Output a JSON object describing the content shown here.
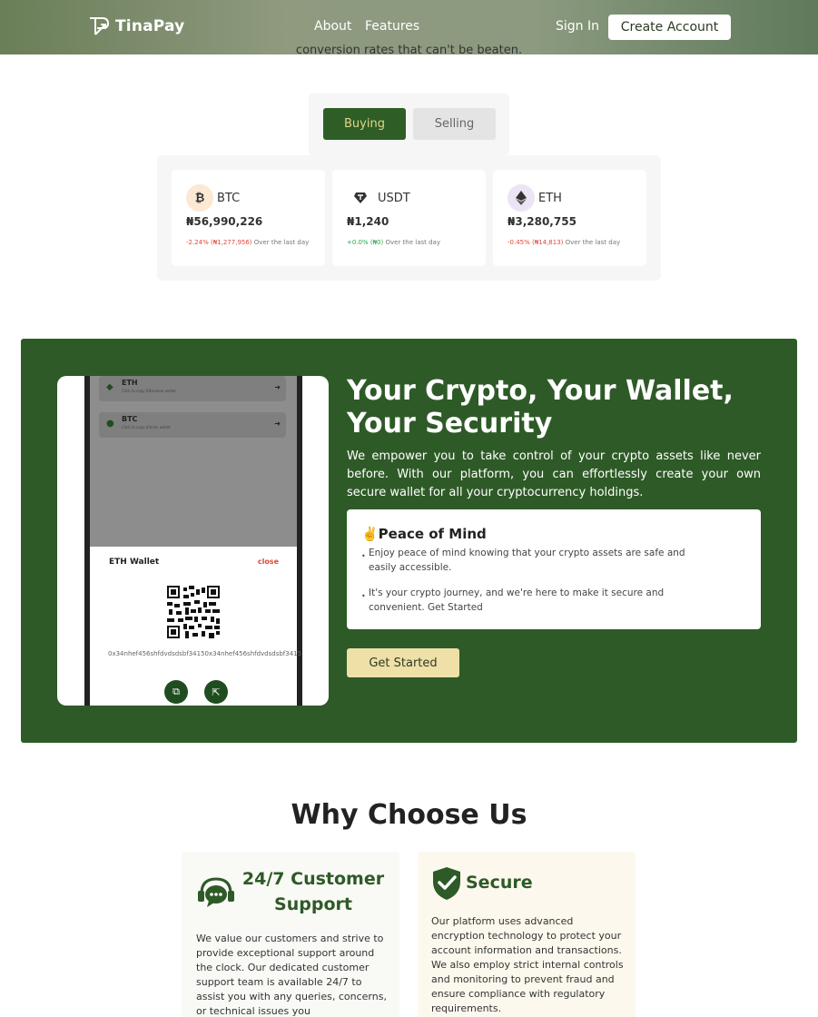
{
  "nav": {
    "brand": "TinaPay",
    "about": "About",
    "features": "Features",
    "sign_in": "Sign In",
    "create_account": "Create Account"
  },
  "intro": {
    "text": "conversion rates that can't be beaten."
  },
  "tabs": {
    "buying": "Buying",
    "selling": "Selling",
    "active": "Buying"
  },
  "rates": [
    {
      "symbol": "BTC",
      "price": "₦56,990,226",
      "change": "-2.24% (₦1,277,956)",
      "period": "Over the last day",
      "direction": "down"
    },
    {
      "symbol": "USDT",
      "price": "₦1,240",
      "change": "+0.0% (₦0)",
      "period": "Over the last day",
      "direction": "up"
    },
    {
      "symbol": "ETH",
      "price": "₦3,280,755",
      "change": "-0.45% (₦14,813)",
      "period": "Over the last day",
      "direction": "down"
    }
  ],
  "wallet": {
    "title": "Your Crypto, Your Wallet, Your Security",
    "description": "We empower you to take control of your crypto assets like never before. With our platform, you can effortlessly create your own secure wallet for all your cryptocurrency holdings.",
    "peace_title": "✌️Peace of Mind",
    "peace_items": [
      "Enjoy peace of mind knowing that your crypto assets are safe and easily accessible.",
      "It's your crypto journey, and we're here to make it secure and convenient. Get Started"
    ],
    "cta": "Get Started",
    "phone": {
      "rows": [
        {
          "name": "ETH",
          "hint": "Click to copy Ethereum wallet"
        },
        {
          "name": "BTC",
          "hint": "Click to copy bitcoin wallet"
        }
      ],
      "sheet_title": "ETH Wallet",
      "close": "close",
      "address": "0x34nhef456shfdvdsdsbf34150x34nhef456shfdvdsdsbf3415"
    }
  },
  "why": {
    "title": "Why Choose Us",
    "cards": [
      {
        "title": "24/7 Customer Support",
        "icon": "support-chat-icon",
        "text": "We value our customers and strive to provide exceptional support around the clock. Our dedicated customer support team is available 24/7 to assist you with any queries, concerns, or technical issues you"
      },
      {
        "title": "Secure",
        "icon": "shield-check-icon",
        "text": "Our platform uses advanced encryption technology to protect your account information and transactions. We also employ strict internal controls and monitoring to prevent fraud and ensure compliance with regulatory requirements."
      }
    ]
  },
  "colors": {
    "brand_green": "#2e5a27",
    "accent_gold": "#efe0a8",
    "negative": "#e0463b",
    "positive": "#22a64f"
  }
}
